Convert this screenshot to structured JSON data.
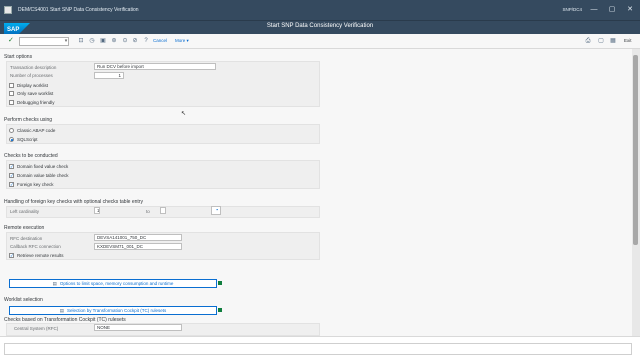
{
  "window": {
    "title": "DEM/CS4001 Start SNP Data Consistency Verification",
    "system_label": "SNP/DC4",
    "minimize_glyph": "—",
    "maximize_glyph": "▢",
    "close_glyph": "✕"
  },
  "shell": {
    "logo_text": "SAP",
    "title": "Start SNP Data Consistency Verification"
  },
  "toolbar": {
    "enter_glyph": "✓",
    "command_value": "",
    "dropdown_glyph": "▾",
    "icons": [
      "save-icon",
      "back-icon",
      "exit-icon",
      "cancel-icon",
      "print-icon",
      "find-icon",
      "help-icon",
      "layout-icon"
    ],
    "icon_glyphs": [
      "⊡",
      "◷",
      "▣",
      "⊛",
      "⊙",
      "⊘",
      "?",
      "▤"
    ],
    "cancel_label": "Cancel",
    "more_label": "More ▾",
    "right_icons": [
      "print-icon",
      "window-icon",
      "customize-icon"
    ],
    "right_glyphs": [
      "⎙",
      "▢",
      "▦"
    ],
    "exit_label": "Exit"
  },
  "start_options": {
    "heading": "Start options",
    "transaction_label": "Transaction description",
    "transaction_value": "Run DCV before import",
    "processes_label": "Number of processes",
    "processes_value": "1",
    "checkboxes": [
      {
        "label": "Display worklist",
        "checked": false
      },
      {
        "label": "Only save worklist",
        "checked": false
      },
      {
        "label": "Debugging friendly",
        "checked": false
      }
    ]
  },
  "perform_checks": {
    "heading": "Perform checks using",
    "options": [
      {
        "label": "Classic ABAP code",
        "selected": false
      },
      {
        "label": "SQLScript",
        "selected": true
      }
    ]
  },
  "checks": {
    "heading": "Checks to be conducted",
    "items": [
      {
        "label": "Domain fixed value check",
        "checked": true
      },
      {
        "label": "Domain value table check",
        "checked": true
      },
      {
        "label": "Foreign key check",
        "checked": true
      }
    ]
  },
  "foreign_key": {
    "heading": "Handling of foreign key checks with optional checks table entry",
    "left_label": "Left cardinality",
    "left_value": "1",
    "to_label": "to",
    "to_value": "",
    "select_glyph": "▪"
  },
  "remote": {
    "heading": "Remote execution",
    "rfc_label": "RFC destination",
    "rfc_value": "DEVSA141001_750_DC",
    "callback_label": "Callback RFC connection",
    "callback_value": "KXDEVSM71_001_DC",
    "retrieve_label": "Retrieve remote results",
    "retrieve_checked": true
  },
  "limit_button": {
    "label": "Options to limit space, memory consumption and runtime"
  },
  "worklist": {
    "heading": "Worklist selection",
    "tc_button": "Selection by Transformation Cockpit (TC) rulesets",
    "subheading": "Checks based on Transformation Cockpit (TC) rulesets",
    "central_label": "Central System (RFC)",
    "central_value": "NONE"
  },
  "status_text": ""
}
